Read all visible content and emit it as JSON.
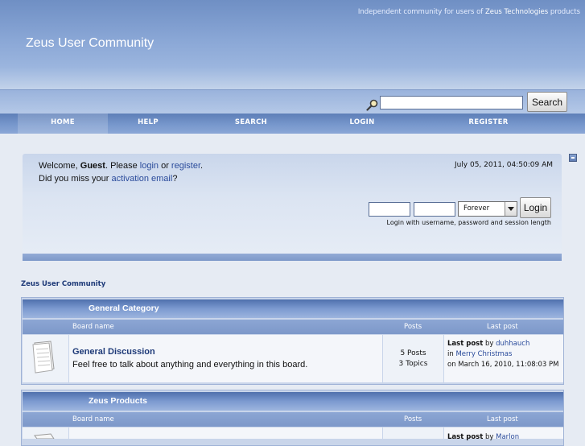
{
  "header": {
    "tagline_prefix": "Independent community for users of",
    "tagline_link": "Zeus Technologies",
    "tagline_suffix": "products",
    "site_title": "Zeus User Community"
  },
  "search": {
    "value": "",
    "button_label": "Search"
  },
  "nav": {
    "items": [
      {
        "label": "HOME"
      },
      {
        "label": "HELP"
      },
      {
        "label": "SEARCH"
      },
      {
        "label": "LOGIN"
      },
      {
        "label": "REGISTER"
      }
    ]
  },
  "welcome": {
    "prefix": "Welcome,",
    "guest": "Guest",
    "please": ". Please",
    "login_link": "login",
    "or": "or",
    "register_link": "register",
    "period": ".",
    "missed_prefix": "Did you miss your",
    "activation_link": "activation email",
    "missed_suffix": "?",
    "date": "July 05, 2011, 04:50:09 AM"
  },
  "login": {
    "username_value": "",
    "password_value": "",
    "session_selected": "Forever",
    "button_label": "Login",
    "hint": "Login with username, password and session length"
  },
  "breadcrumb": "Zeus User Community",
  "columns": {
    "board_name": "Board name",
    "posts": "Posts",
    "last_post": "Last post"
  },
  "categories": [
    {
      "title": "General Category",
      "boards": [
        {
          "title": "General Discussion",
          "description": "Feel free to talk about anything and everything in this board.",
          "posts": "5 Posts",
          "topics": "3 Topics",
          "last_post_label": "Last post",
          "last_post_by": "by",
          "last_post_user": "duhhauch",
          "last_post_in": "in",
          "last_post_topic": "Merry Christmas",
          "last_post_date": "on March 16, 2010, 11:08:03 PM"
        }
      ]
    },
    {
      "title": "Zeus Products",
      "boards": [
        {
          "last_post_label": "Last post",
          "last_post_by": "by",
          "last_post_user": "Marlon"
        }
      ]
    }
  ],
  "colors": {
    "link": "#2a4b9b",
    "header_top": "#6f8fc4",
    "nav": "#6f8fc4"
  }
}
